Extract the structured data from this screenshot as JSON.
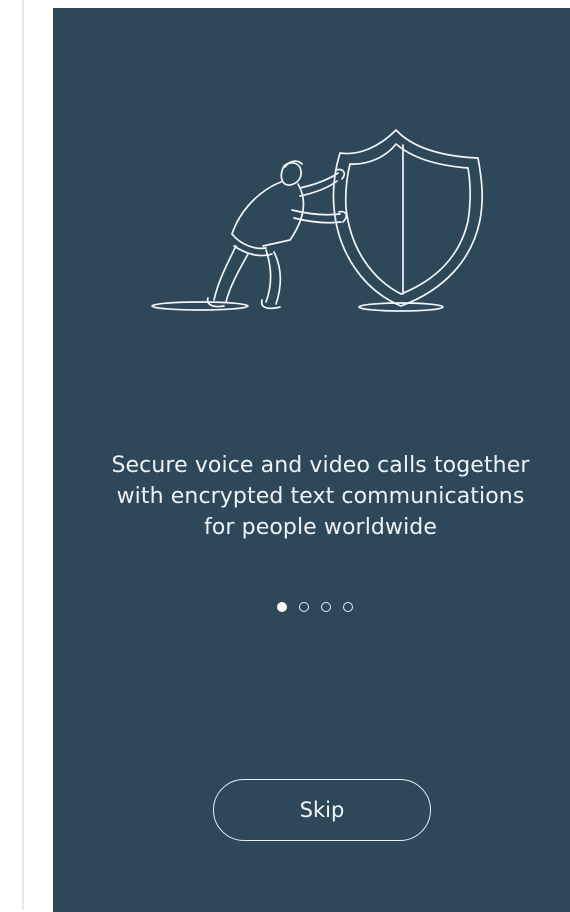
{
  "theme": {
    "background": "#2f4859",
    "line": "#f2f5f7",
    "text": "#eef3f6"
  },
  "onboarding": {
    "illustration": {
      "icon": "person-pushing-shield-icon"
    },
    "tagline": {
      "line1": "Secure voice and video calls together",
      "line2": "with encrypted text communications",
      "line3": "for people worldwide"
    },
    "pagination": {
      "pages": 4,
      "current": 1
    },
    "skip_label": "Skip"
  }
}
